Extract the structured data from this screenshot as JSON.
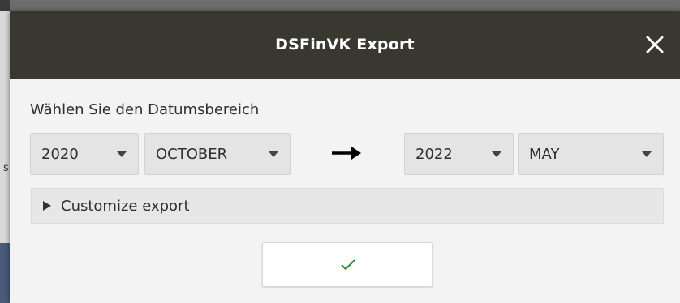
{
  "background": {
    "fragment_text": "s"
  },
  "dialog": {
    "title": "DSFinVK Export",
    "close_icon": "close-icon",
    "subtitle": "Wählen Sie den Datumsbereich",
    "from": {
      "year": "2020",
      "month": "OCTOBER"
    },
    "to": {
      "year": "2022",
      "month": "MAY"
    },
    "arrow_icon": "arrow-right-icon",
    "customize_label": "Customize export",
    "confirm_icon": "checkmark-icon",
    "colors": {
      "header_bg": "#383831",
      "body_bg": "#f3f3f3",
      "confirm_check": "#2e8b2e"
    }
  }
}
